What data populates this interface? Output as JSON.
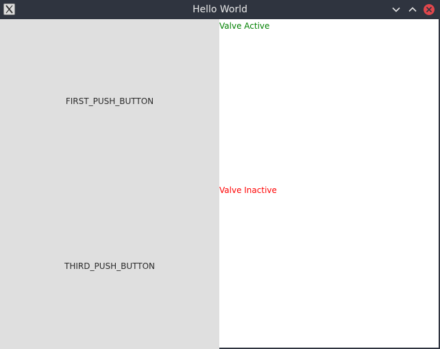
{
  "window": {
    "title": "Hello World",
    "titlebar_color": "#2f343f",
    "icons": {
      "app": "x-app-icon",
      "minimize": "chevron-down-icon",
      "maximize": "chevron-up-icon",
      "close": "close-icon"
    },
    "close_color": "#e0474c"
  },
  "main": {
    "first_button_label": "FIRST_PUSH_BUTTON",
    "third_button_label": "THIRD_PUSH_BUTTON",
    "valve_active_label": "Valve Active",
    "valve_inactive_label": "Valve Inactive",
    "valve_active_color": "#008000",
    "valve_inactive_color": "#ff0000",
    "button_color": "#dfdfdf"
  }
}
